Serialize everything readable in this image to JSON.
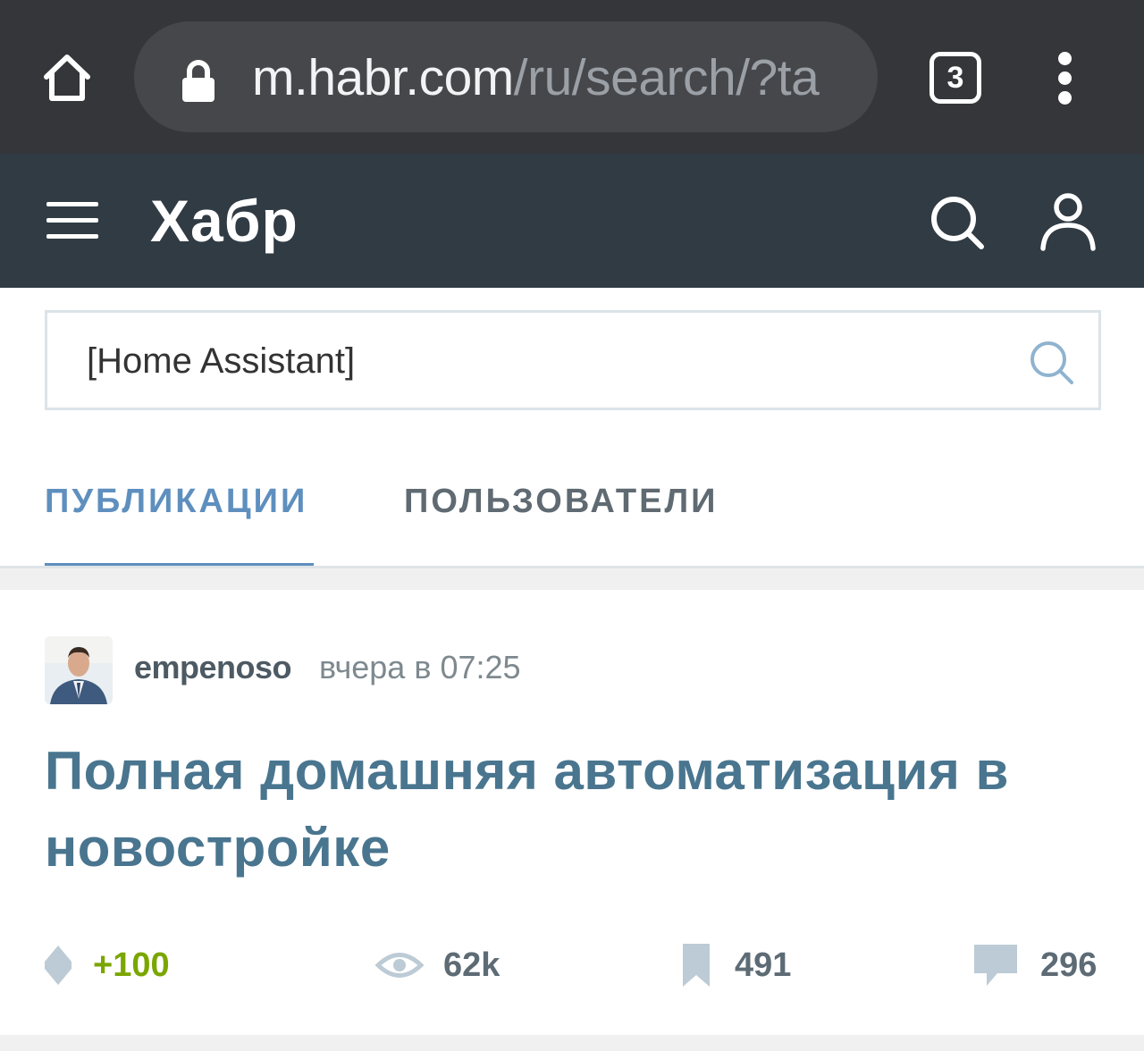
{
  "browser": {
    "url_host": "m.habr.com",
    "url_path": "/ru/search/?ta",
    "tab_count": "3",
    "icons": [
      "home-icon",
      "lock-icon",
      "more-vert-icon"
    ]
  },
  "header": {
    "logo": "Хабр",
    "icons": [
      "menu-icon",
      "search-icon",
      "user-icon"
    ]
  },
  "search": {
    "value": "[Home Assistant]"
  },
  "tabs": [
    {
      "label": "ПУБЛИКАЦИИ",
      "active": true
    },
    {
      "label": "ПОЛЬЗОВАТЕЛИ",
      "active": false
    }
  ],
  "post": {
    "author": "empenoso",
    "time": "вчера в 07:25",
    "title": "Полная домашняя автоматизация в новостройке",
    "stats": {
      "rating": "+100",
      "views": "62k",
      "bookmarks": "491",
      "comments": "296"
    }
  },
  "colors": {
    "chrome_bg": "#35363a",
    "header_bg": "#303b44",
    "accent_tab": "#5e8fbe",
    "title": "#49758f",
    "rating_positive": "#7aa600"
  }
}
